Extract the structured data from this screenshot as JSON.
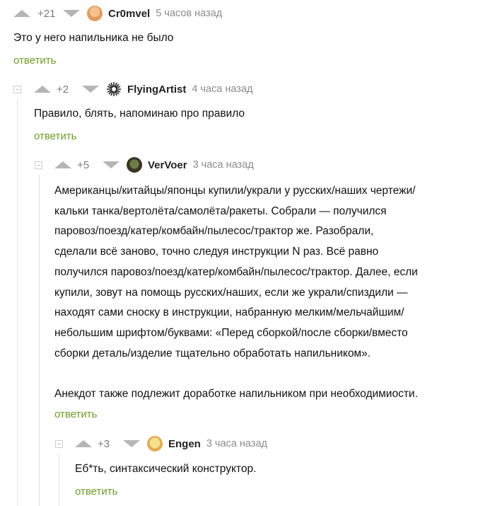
{
  "comments": [
    {
      "rating": "+21",
      "author": "Cr0mvel",
      "time": "5 часов назад",
      "avatar_icon": "user-avatar",
      "text": "Это у него напильника не было",
      "reply": "ответить"
    },
    {
      "rating": "+2",
      "author": "FlyingArtist",
      "time": "4 часа назад",
      "avatar_icon": "user-avatar",
      "text": "Правило, блять, напоминаю про правило",
      "reply": "ответить"
    },
    {
      "rating": "+5",
      "author": "VerVoer",
      "time": "3 часа назад",
      "avatar_icon": "user-avatar",
      "text": "Американцы/китайцы/японцы купили/украли у русских/наших чертежи/\nкальки танка/вертолёта/самолёта/ракеты. Собрали — получился\nпаровоз/поезд/катер/комбайн/пылесос/трактор же. Разобрали,\nсделали всё заново, точно следуя инструкции N раз. Всё равно\nполучился паровоз/поезд/катер/комбайн/пылесос/трактор. Далее, если\nкупили, зовут на помощь русских/наших, если же украли/спиздили —\nнаходят сами сноску в инструкции, набранную мелким/мельчайшим/\nнебольшим шрифтом/буквами: «Перед сборкой/после сборки/вместо\nсборки деталь/изделие тщательно обработать напильником».\n\nАнекдот также подлежит доработке напильником при необходимиости.",
      "reply": "ответить"
    },
    {
      "rating": "+3",
      "author": "Engen",
      "time": "3 часа назад",
      "avatar_icon": "user-avatar",
      "text": "Еб*ть, синтаксический конструктор.",
      "reply": "ответить"
    }
  ],
  "colors": {
    "reply_link": "#6b9f22",
    "vote_arrow": "#b5b5b5",
    "meta_text": "#8c8c8c"
  }
}
